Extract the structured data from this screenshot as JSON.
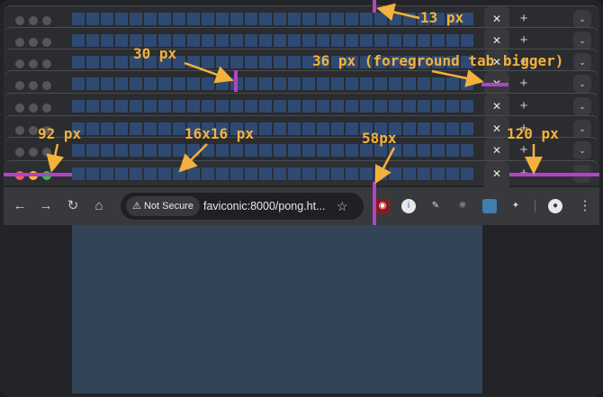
{
  "tab_strip": {
    "close_label": "✕",
    "new_tab_label": "+",
    "overflow_label": "⌄",
    "icon_count": 28
  },
  "toolbar": {
    "back_icon": "←",
    "forward_icon": "→",
    "reload_icon": "↻",
    "home_icon": "⌂",
    "security_chip": "Not Secure",
    "url": "faviconic:8000/pong.ht...",
    "bookmark_icon": "☆",
    "menu_icon": "⋮"
  },
  "annotations": {
    "a13": "13 px",
    "a30": "30 px",
    "a36": "36 px (foreground tab bigger)",
    "a92": "92 px",
    "a16": "16x16 px",
    "a58": "58px",
    "a120": "120 px"
  },
  "colors": {
    "marker": "#b144c6",
    "annotation": "#f4b13c",
    "favicon": "#2f4a72"
  }
}
